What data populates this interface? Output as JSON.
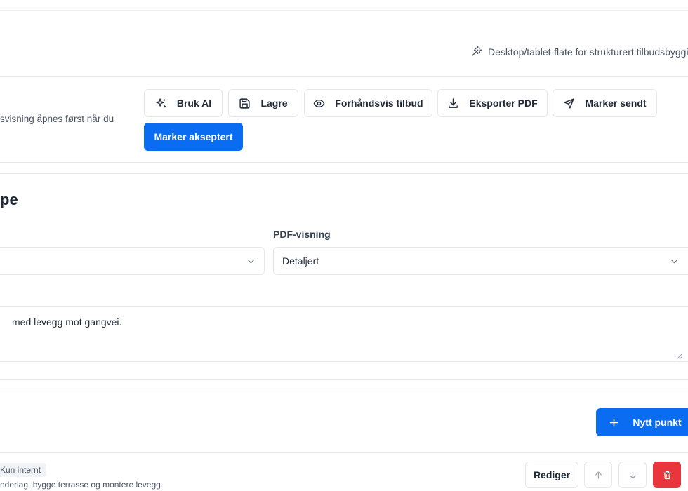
{
  "header": {
    "tagline": "Desktop/tablet-flate for strukturert tilbudsbygging",
    "tagline_icon": "magic-wand-icon"
  },
  "toolbar": {
    "subtitle": "svisning åpnes først når du",
    "buttons": {
      "ai": "Bruk AI",
      "save": "Lagre",
      "preview": "Forhåndsvis tilbud",
      "export": "Eksporter PDF",
      "sent": "Marker sendt",
      "accept": "Marker akseptert"
    }
  },
  "section": {
    "title": "pe",
    "pdf_view_label": "PDF-visning",
    "pdf_view_value": "Detaljert",
    "first_select_value": "",
    "description": "med levegg mot gangvei."
  },
  "items": {
    "new_item_label": "Nytt punkt",
    "row": {
      "badge": "Kun internt",
      "description": "nderlag, bygge terrasse og montere levegg.",
      "edit_label": "Rediger"
    }
  },
  "colors": {
    "primary": "#0a6cf0",
    "danger": "#e8363c",
    "border": "#e5e7eb",
    "text": "#1f2937"
  }
}
